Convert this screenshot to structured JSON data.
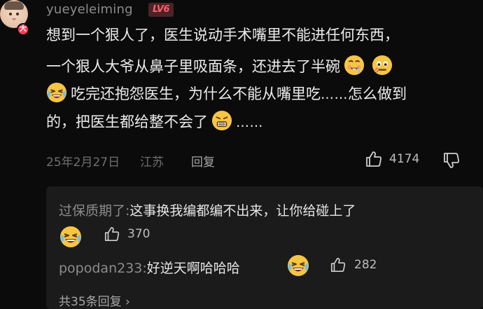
{
  "comment": {
    "username": "yueyeleiming",
    "level_badge": "LV6",
    "avatar_badge": "大",
    "lines": [
      "想到一个狠人了，医生说动手术嘴里不能进任何东西，",
      "一个狠人大爷从鼻子里吸面条，还进去了半碗",
      "吃完还抱怨医生，为什么不能从嘴里吃",
      "怎么做到",
      "的，把医生都给整不会了"
    ],
    "ellipsis_1": "……",
    "ellipsis_2": "……",
    "date": "25年2月27日",
    "location": "江苏",
    "reply_label": "回复",
    "like_count": "4174"
  },
  "replies": [
    {
      "username": "过保质期了:",
      "text": "这事换我编都编不出来，让你给碰上了",
      "like_count": "370"
    },
    {
      "username": "popodan233:",
      "text": "好逆天啊哈哈哈",
      "like_count": "282"
    }
  ],
  "more_replies_label": "共35条回复",
  "more_replies_chevron": "›",
  "icons": {
    "like": "thumbs-up-icon",
    "dislike": "thumbs-down-icon",
    "emoji_drool": "drooling-face-emoji",
    "emoji_flushed": "flushed-face-emoji",
    "emoji_cry_laugh": "crying-laughing-emoji"
  },
  "colors": {
    "background": "#0b0b0b",
    "reply_panel": "#1b1b1b",
    "level_badge_bg": "#4a2426",
    "level_badge_text": "#ff5f6d",
    "age_badge": "#ff3b5c",
    "emoji_yellow": "#f6c544"
  }
}
